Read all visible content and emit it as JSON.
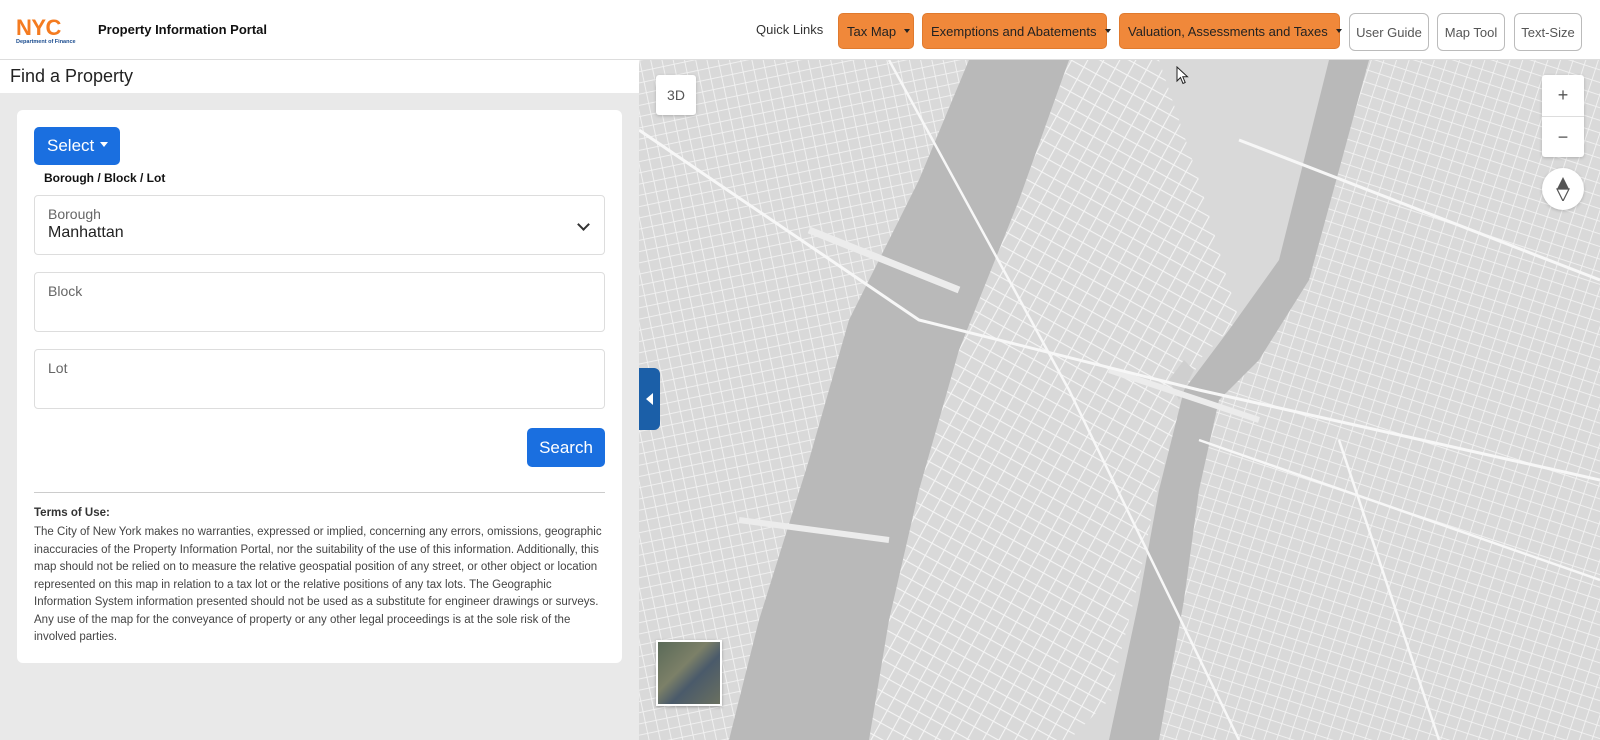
{
  "header": {
    "logo_nyc": "NYC",
    "logo_dept": "Department of Finance",
    "app_title": "Property Information Portal",
    "quick_links": "Quick Links",
    "menus": [
      {
        "label": "Tax Map"
      },
      {
        "label": "Exemptions and Abatements"
      },
      {
        "label": "Valuation, Assessments and Taxes"
      }
    ],
    "buttons": [
      {
        "label": "User Guide"
      },
      {
        "label": "Map Tool"
      },
      {
        "label": "Text-Size"
      }
    ]
  },
  "panel": {
    "title": "Find a Property",
    "select_label": "Select",
    "mode_label": "Borough / Block / Lot",
    "borough": {
      "label": "Borough",
      "value": "Manhattan"
    },
    "block": {
      "label": "Block",
      "value": ""
    },
    "lot": {
      "label": "Lot",
      "value": ""
    },
    "search_label": "Search",
    "terms_title": "Terms of Use:",
    "terms_body": "The City of New York makes no warranties, expressed or implied, concerning any errors, omissions, geographic inaccuracies of the Property Information Portal, nor the suitability of the use of this information. Additionally, this map should not be relied on to measure the relative geospatial position of any street, or other object or location represented on this map in relation to a tax lot or the relative positions of any tax lots. The Geographic Information System information presented should not be used as a substitute for engineer drawings or surveys. Any use of the map for the conveyance of property or any other legal proceedings is at the sole risk of the involved parties."
  },
  "map": {
    "view_3d_label": "3D",
    "zoom_in": "+",
    "zoom_out": "−"
  },
  "colors": {
    "accent_orange": "#f0883a",
    "primary_blue": "#1a6fe0",
    "collapse_blue": "#1b5fa8",
    "map_land": "#d9d9d9",
    "map_water": "#b8b8b8"
  }
}
